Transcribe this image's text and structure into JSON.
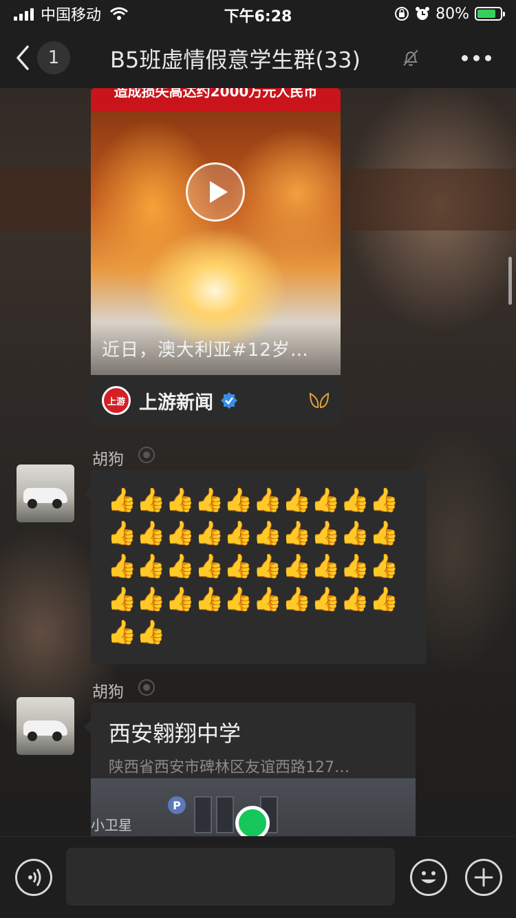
{
  "status_bar": {
    "carrier": "中国移动",
    "time": "下午6:28",
    "battery": "80%",
    "battery_level": 0.8
  },
  "nav": {
    "back_count": "1",
    "title": "B5班虚情假意学生群(33)"
  },
  "video_card": {
    "header_text": "造成损失高达约2000万元人民币",
    "caption": "近日，澳大利亚#12岁…",
    "source_logo_text": "上游",
    "source_name": "上游新闻"
  },
  "messages": [
    {
      "sender": "胡狗",
      "type": "text",
      "text": "👍👍👍👍👍👍👍👍👍👍👍👍👍👍👍👍👍👍👍👍👍👍👍👍👍👍👍👍👍👍👍👍👍👍👍👍👍👍👍👍👍👍"
    },
    {
      "sender": "胡狗",
      "type": "location",
      "title": "西安翱翔中学",
      "address": "陕西省西安市碑林区友谊西路127…",
      "map_parking": "P",
      "map_label": "小卫星"
    }
  ],
  "input": {
    "placeholder": ""
  },
  "colors": {
    "accent_green": "#16c65a",
    "bubble": "#2c2c2c",
    "bar": "#1e1e1e",
    "verified_blue": "#3a8ee6",
    "news_red": "#c9141b"
  }
}
